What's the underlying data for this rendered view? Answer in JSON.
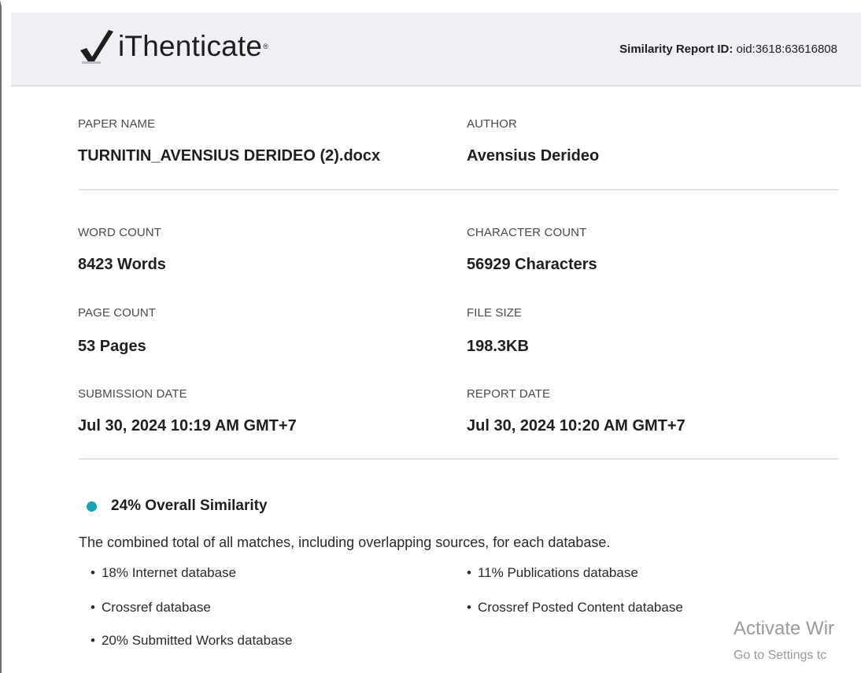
{
  "header": {
    "logo_text": "iThenticate",
    "logo_reg": "®",
    "report_id_label": "Similarity Report ID:",
    "report_id_value": " oid:3618:63616808"
  },
  "paper": {
    "paper_name_label": "PAPER NAME",
    "paper_name": "TURNITIN_AVENSIUS DERIDEO (2).docx",
    "author_label": "AUTHOR",
    "author": "Avensius Derideo"
  },
  "stats": {
    "word_count_label": "WORD COUNT",
    "word_count": "8423 Words",
    "character_count_label": "CHARACTER COUNT",
    "character_count": "56929 Characters",
    "page_count_label": "PAGE COUNT",
    "page_count": "53 Pages",
    "file_size_label": "FILE SIZE",
    "file_size": "198.3KB",
    "submission_date_label": "SUBMISSION DATE",
    "submission_date": "Jul 30, 2024 10:19 AM GMT+7",
    "report_date_label": "REPORT DATE",
    "report_date": "Jul 30, 2024 10:20 AM GMT+7"
  },
  "similarity": {
    "title": "24% Overall Similarity",
    "description": "The combined total of all matches, including overlapping sources, for each database.",
    "left_items": [
      "18% Internet database",
      "Crossref database",
      "20% Submitted Works database"
    ],
    "right_items": [
      "11% Publications database",
      "Crossref Posted Content database"
    ],
    "dot_color": "#1aa3b5"
  },
  "watermark": {
    "line1": "Activate Wir",
    "line2": "Go to Settings tc"
  },
  "colors": {
    "header_bg": "#eef0f3",
    "logo_check": "#1e1e1e"
  }
}
